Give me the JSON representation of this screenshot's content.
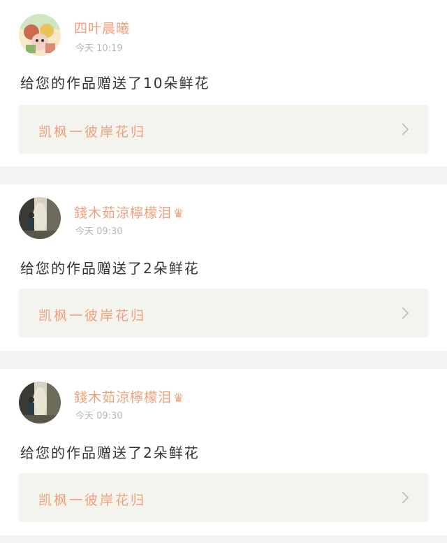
{
  "notifications": [
    {
      "username": "四叶晨曦",
      "has_crown": false,
      "time": "今天 10:19",
      "message": "给您的作品赠送了10朵鲜花",
      "work_title": "凯枫一彼岸花归",
      "avatar": "cartoon-avatar"
    },
    {
      "username": "錢木茹涼檸檬泪",
      "has_crown": true,
      "time": "今天 09:30",
      "message": "给您的作品赠送了2朵鲜花",
      "work_title": "凯枫一彼岸花归",
      "avatar": "photo-avatar"
    },
    {
      "username": "錢木茹涼檸檬泪",
      "has_crown": true,
      "time": "今天 09:30",
      "message": "给您的作品赠送了2朵鲜花",
      "work_title": "凯枫一彼岸花归",
      "avatar": "photo-avatar"
    }
  ],
  "icons": {
    "crown": "♛",
    "chevron": "chevron-right-icon"
  },
  "colors": {
    "accent": "#f0a07a",
    "time": "#b8b8b8",
    "text": "#333333",
    "link_bg": "#f4f4ee",
    "page_bg": "#f3f3f3",
    "card_bg": "#ffffff"
  }
}
